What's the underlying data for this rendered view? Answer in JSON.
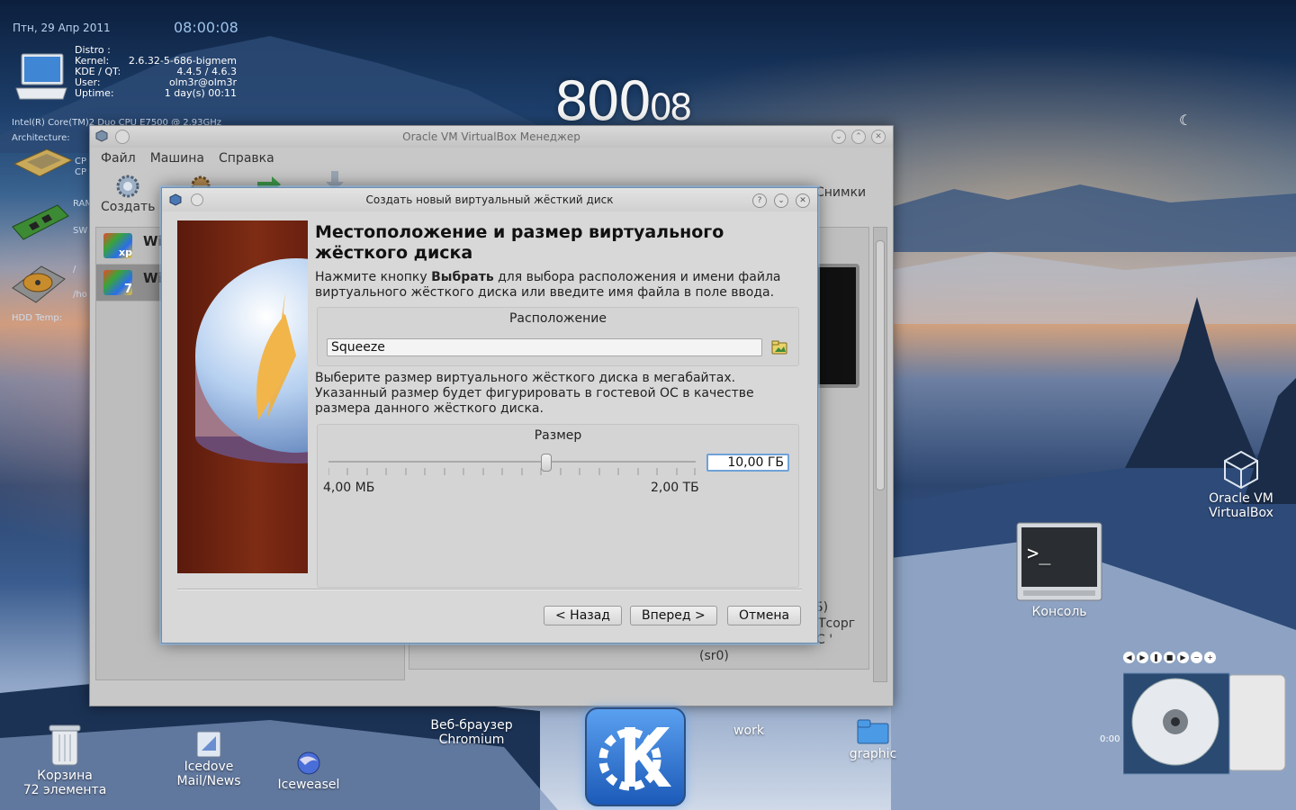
{
  "desktop": {
    "date": "Птн, 29 Апр 2011",
    "time": "08:00:08",
    "big_clock_main": "800",
    "big_clock_sec": "08",
    "system": {
      "rows": [
        {
          "label": "Distro :",
          "value": ""
        },
        {
          "label": "Kernel:",
          "value": "2.6.32-5-686-bigmem"
        },
        {
          "label": "KDE / QT:",
          "value": "4.4.5 / 4.6.3"
        },
        {
          "label": "User:",
          "value": "olm3r@olm3r"
        },
        {
          "label": "Uptime:",
          "value": "1 day(s)  00:11"
        }
      ],
      "cpu": "Intel(R) Core(TM)2 Duo CPU      E7500  @ 2.93GHz",
      "architecture": "Architecture:",
      "cp1": "CP",
      "cp2": "CP",
      "ram": "RAM",
      "swap": "SW",
      "slash": "/",
      "home": "/ho",
      "hdd_temp": "HDD Temp:"
    },
    "icons": {
      "trash": "Корзина",
      "trash_count": "72 элемента",
      "icedove": "Icedove",
      "icedove_sub": "Mail/News",
      "iceweasel": "Iceweasel",
      "chromium": "Веб-браузер",
      "chromium_sub": "Chromium",
      "work": "work",
      "graphic": "graphic",
      "vbox": "Oracle VM",
      "vbox_sub": "VirtualBox",
      "console": "Консоль"
    },
    "player_time": "0:00"
  },
  "vbox_window": {
    "title": "Oracle VM VirtualBox Менеджер",
    "menu": [
      "Файл",
      "Машина",
      "Справка"
    ],
    "toolbar_create": "Создать",
    "toolbar_snapshots": "Снимки",
    "vm_items": [
      {
        "name": "Wi",
        "badge": "xp"
      },
      {
        "name": "Wi",
        "badge": "7"
      }
    ],
    "detail_fragments": [
      "Б)",
      "Тсорг",
      "С '",
      "(sr0)"
    ]
  },
  "dialog": {
    "title": "Создать новый виртуальный жёсткий диск",
    "heading": "Местоположение и размер виртуального жёсткого диска",
    "desc1_pre": "Нажмите кнопку ",
    "desc1_bold": "Выбрать",
    "desc1_post": " для выбора расположения и имени файла виртуального жёсткого диска или введите имя файла в поле ввода.",
    "location_group": "Расположение",
    "location_value": "Squeeze",
    "desc2": "Выберите размер виртуального жёсткого диска в мегабайтах. Указанный размер будет фигурировать в гостевой ОС в качестве размера данного жёсткого диска.",
    "size_group": "Размер",
    "size_value": "10,00 ГБ",
    "size_fraction": 0.59,
    "min_label": "4,00 МБ",
    "max_label": "2,00 ТБ",
    "back": "< Назад",
    "next": "Вперед >",
    "cancel": "Отмена"
  }
}
